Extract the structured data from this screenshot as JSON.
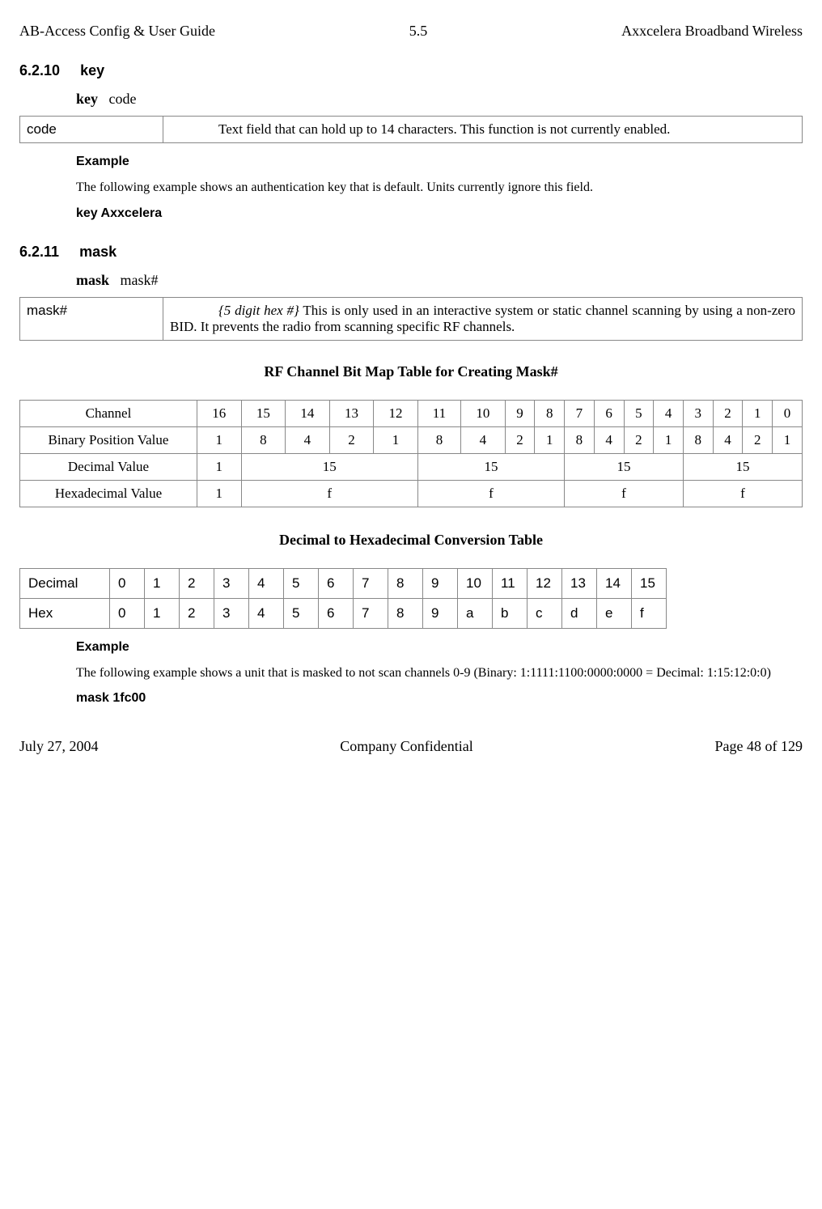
{
  "header": {
    "left": "AB-Access Config & User Guide",
    "center": "5.5",
    "right": "Axxcelera Broadband Wireless"
  },
  "footer": {
    "left": "July 27, 2004",
    "center": "Company Confidential",
    "right": "Page 48 of 129"
  },
  "sec_key": {
    "num": "6.2.10",
    "title": "key",
    "syntax_cmd": "key",
    "syntax_arg": "code",
    "param_name": "code",
    "param_desc": "Text field that can hold up to 14 characters.  This function is not currently enabled.",
    "example_label": "Example",
    "example_text": "The following example shows an authentication key that is default.  Units currently ignore this field.",
    "example_cmd": "key   Axxcelera"
  },
  "sec_mask": {
    "num": "6.2.11",
    "title": "mask",
    "syntax_cmd": "mask",
    "syntax_arg": "mask#",
    "param_name": "mask#",
    "param_italic": "{5 digit hex #}",
    "param_desc_rest": " This is only used in an interactive system or static channel scanning by using a non-zero BID. It prevents the radio from scanning specific RF channels."
  },
  "bitmap_title": "RF Channel Bit Map Table for Creating Mask#",
  "bitmap": {
    "rows": {
      "channel_label": "Channel",
      "binary_label": "Binary Position Value",
      "decimal_label": "Decimal Value",
      "hex_label": "Hexadecimal Value"
    },
    "channel": [
      "16",
      "15",
      "14",
      "13",
      "12",
      "11",
      "10",
      "9",
      "8",
      "7",
      "6",
      "5",
      "4",
      "3",
      "2",
      "1",
      "0"
    ],
    "binary": [
      "1",
      "8",
      "4",
      "2",
      "1",
      "8",
      "4",
      "2",
      "1",
      "8",
      "4",
      "2",
      "1",
      "8",
      "4",
      "2",
      "1"
    ],
    "decimal": [
      "1",
      "15",
      "15",
      "15",
      "15"
    ],
    "hex": [
      "1",
      "f",
      "f",
      "f",
      "f"
    ]
  },
  "conv_title": "Decimal to Hexadecimal Conversion Table",
  "conv": {
    "dec_label": "Decimal",
    "hex_label": "Hex",
    "dec": [
      "0",
      "1",
      "2",
      "3",
      "4",
      "5",
      "6",
      "7",
      "8",
      "9",
      "10",
      "11",
      "12",
      "13",
      "14",
      "15"
    ],
    "hex": [
      "0",
      "1",
      "2",
      "3",
      "4",
      "5",
      "6",
      "7",
      "8",
      "9",
      "a",
      "b",
      "c",
      "d",
      "e",
      "f"
    ]
  },
  "mask_example": {
    "label": "Example",
    "text": "The following example shows a unit that is masked to not scan channels 0-9 (Binary: 1:1111:1100:0000:0000 = Decimal: 1:15:12:0:0)",
    "cmd": "mask   1fc00"
  }
}
